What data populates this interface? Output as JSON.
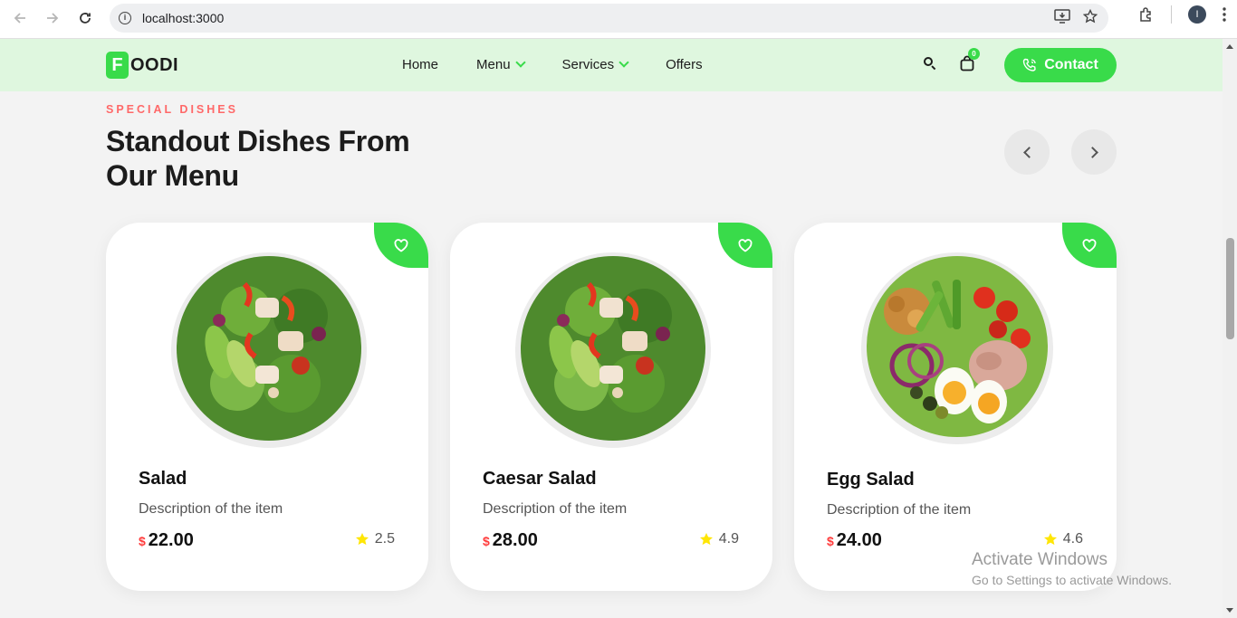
{
  "browser": {
    "url": "localhost:3000",
    "profile_initial": "I"
  },
  "brand": {
    "logo_letter": "F",
    "logo_rest": "OODI",
    "accent": "#39db4a",
    "header_bg": "#dff7df"
  },
  "nav": {
    "items": [
      {
        "label": "Home"
      },
      {
        "label": "Menu"
      },
      {
        "label": "Services"
      },
      {
        "label": "Offers"
      }
    ],
    "cart_count": "0",
    "contact_label": "Contact"
  },
  "section": {
    "eyebrow": "SPECIAL DISHES",
    "title": "Standout Dishes From Our Menu"
  },
  "cards": [
    {
      "title": "Salad",
      "description": "Description of the item",
      "currency": "$",
      "price": "22.00",
      "rating": "2.5",
      "image": "chicken-salad-bowl"
    },
    {
      "title": "Caesar Salad",
      "description": "Description of the item",
      "currency": "$",
      "price": "28.00",
      "rating": "4.9",
      "image": "chicken-salad-bowl"
    },
    {
      "title": "Egg Salad",
      "description": "Description of the item",
      "currency": "$",
      "price": "24.00",
      "rating": "4.6",
      "image": "egg-tuna-salad-bowl"
    }
  ],
  "watermark": {
    "line1": "Activate Windows",
    "line2": "Go to Settings to activate Windows."
  }
}
